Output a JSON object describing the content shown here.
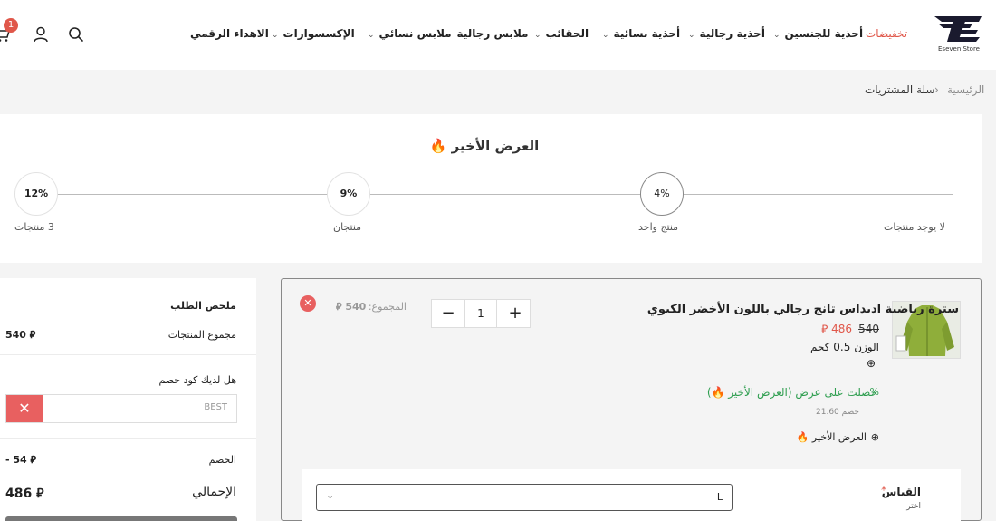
{
  "header": {
    "brand": "Eseven Store",
    "nav": [
      "تخفيضات",
      "أحذية للجنسين",
      "أحذية رجالية",
      "أحذية نسائية",
      "الحقائب",
      "ملابس رجالية",
      "ملابس نسائي",
      "الإكسسوارات",
      "الاهداء الرقمي"
    ],
    "cart_count": "1",
    "icons": [
      "search-icon",
      "user-icon",
      "cart-icon",
      "chevron-down-icon"
    ]
  },
  "breadcrumb": {
    "home": "الرئيسية",
    "separator": "›",
    "current": "سلة المشتريات"
  },
  "offer": {
    "title": "العرض الأخير 🔥",
    "steps": [
      {
        "percent": "",
        "label": "لا يوجد منتجات"
      },
      {
        "percent": "4%",
        "label": "منتج واحد"
      },
      {
        "percent": "9%",
        "label": "منتجان"
      },
      {
        "percent": "12%",
        "label": "3 منتجات"
      }
    ]
  },
  "summary": {
    "title": "ملخص الطلب",
    "subtotal_label": "مجموع المنتجات",
    "subtotal_value": "540 ⃁",
    "coupon_question": "هل لديك كود خصم",
    "coupon_value": "BEST",
    "discount_label": "الخصم",
    "discount_value": "- 54 ⃁",
    "total_label": "الإجمالي",
    "total_value": "486 ⃁"
  },
  "cart_item": {
    "title": "سترة رياضية اديداس تانج رجالي باللون الأخضر الكيوي",
    "price_new": "486 ⃁",
    "price_old": "540",
    "weight": "الوزن 0.5 كجم",
    "quantity": "1",
    "total_label": "المجموع:",
    "total_value": "540 ⃁",
    "offer_applied": "حصلت على عرض (العرض الأخير 🔥)",
    "discount_note": "خصم 21.60",
    "offer_tag": "العرض الأخير 🔥",
    "size_label": "القياس",
    "size_required": "*",
    "size_hint": "اختر",
    "size_value": "L"
  },
  "colors": {
    "accent": "#e0574a",
    "success": "#2e9e4f",
    "remove": "#e86060"
  }
}
